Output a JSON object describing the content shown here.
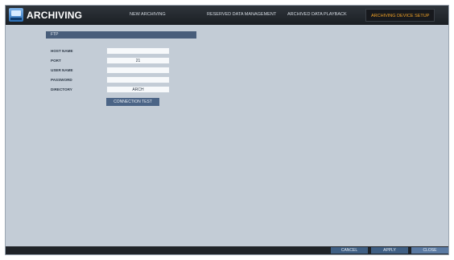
{
  "header": {
    "title": "ARCHIVING",
    "icon": "archive-monitor-icon",
    "tabs": [
      {
        "label": "NEW ARCHIVING"
      },
      {
        "label": "RESERVED DATA MANAGEMENT"
      },
      {
        "label": "ARCHIVED DATA PLAYBACK"
      },
      {
        "label": "ARCHIVING DEVICE SETUP"
      }
    ],
    "active_tab": "ARCHIVING DEVICE SETUP",
    "active_color": "#f0a126"
  },
  "ftp": {
    "section_title": "FTP",
    "fields": {
      "host_name": {
        "label": "HOST NAME",
        "value": ""
      },
      "port": {
        "label": "PORT",
        "value": "21"
      },
      "user_name": {
        "label": "USER NAME",
        "value": ""
      },
      "password": {
        "label": "PASSWORD",
        "value": ""
      },
      "directory": {
        "label": "DIRECTORY",
        "value": "ARCH"
      }
    },
    "connection_test_label": "CONNECTION TEST"
  },
  "footer": {
    "cancel_label": "CANCEL",
    "apply_label": "APPLY",
    "close_label": "CLOSE"
  }
}
